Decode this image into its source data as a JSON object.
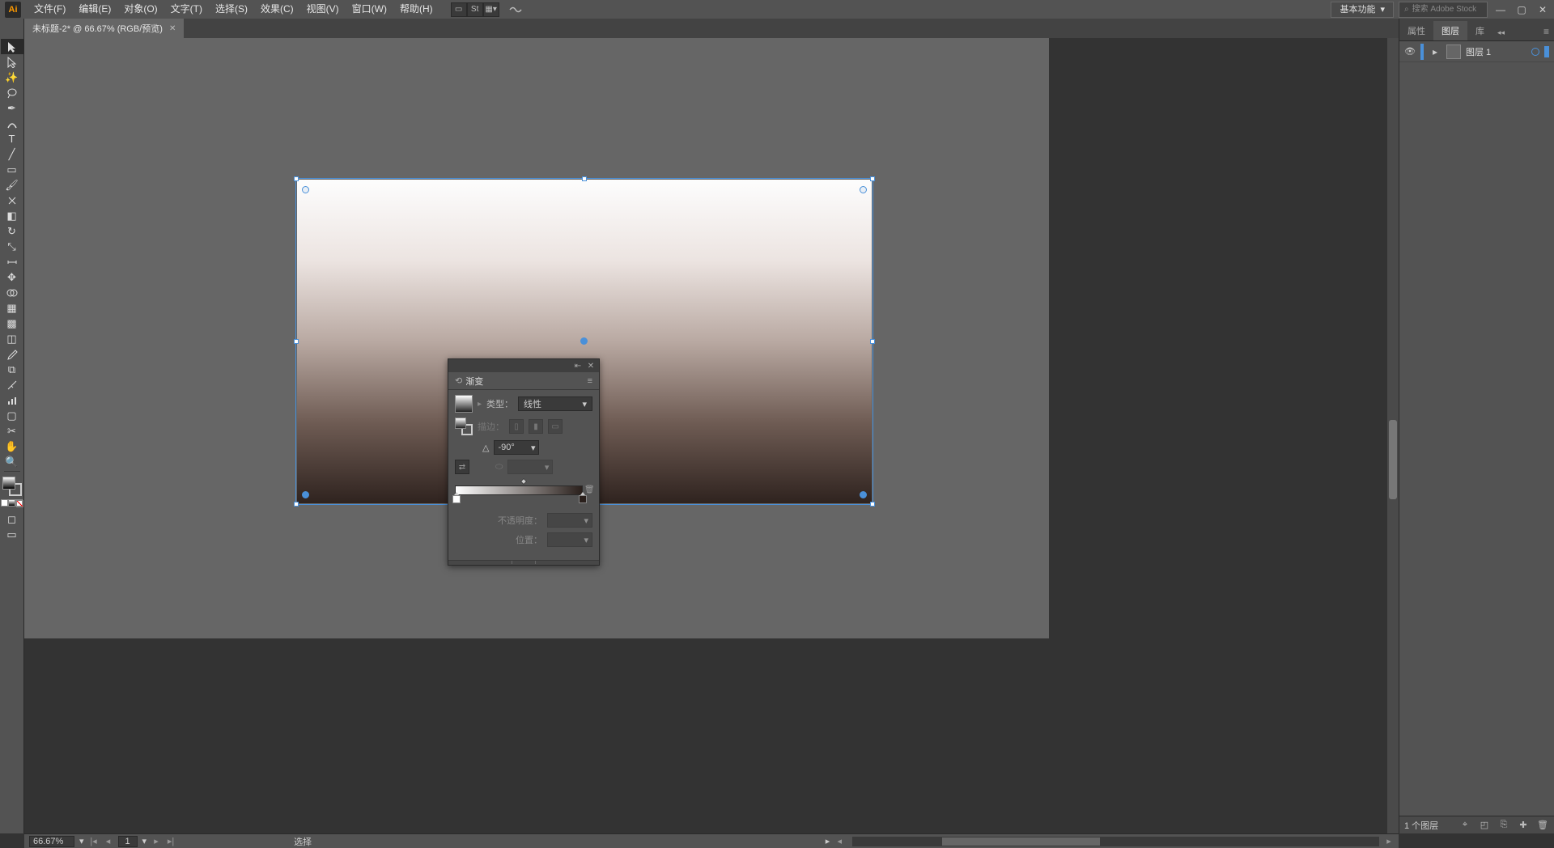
{
  "app": {
    "logo": "Ai"
  },
  "menu": {
    "items": [
      "文件(F)",
      "编辑(E)",
      "对象(O)",
      "文字(T)",
      "选择(S)",
      "效果(C)",
      "视图(V)",
      "窗口(W)",
      "帮助(H)"
    ]
  },
  "topbar": {
    "workspace": "基本功能",
    "search_placeholder": "搜索 Adobe Stock"
  },
  "document": {
    "tab_title": "未标题-2* @ 66.67% (RGB/预览)"
  },
  "status": {
    "zoom": "66.67%",
    "artboard": "1",
    "tool": "选择"
  },
  "gradient_panel": {
    "title": "渐变",
    "type_label": "类型：",
    "type_value": "线性",
    "stroke_label": "描边：",
    "angle_value": "-90°",
    "opacity_label": "不透明度：",
    "position_label": "位置："
  },
  "layers_panel": {
    "tabs": [
      "属性",
      "图层",
      "库"
    ],
    "active_tab": 1,
    "layer_name": "图层 1",
    "footer_count": "1 个图层"
  }
}
